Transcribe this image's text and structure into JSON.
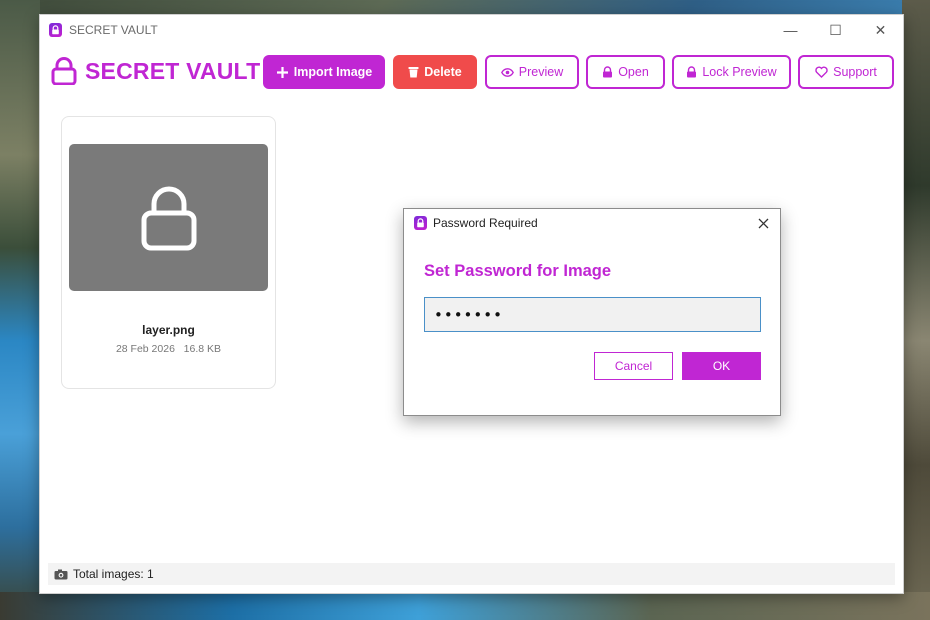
{
  "window": {
    "title": "SECRET VAULT",
    "controls": {
      "minimize": "—",
      "maximize": "☐",
      "close": "✕"
    }
  },
  "brand": {
    "name": "SECRET VAULT",
    "icon": "lock-icon"
  },
  "toolbar": {
    "import_label": "Import Image",
    "delete_label": "Delete",
    "preview_label": "Preview",
    "open_label": "Open",
    "lock_preview_label": "Lock Preview",
    "support_label": "Support"
  },
  "gallery": {
    "items": [
      {
        "name": "layer.png",
        "date": "28 Feb 2026",
        "size": "16.8 KB",
        "meta": "28 Feb 2026   16.8 KB"
      }
    ]
  },
  "status": {
    "text": "Total images: 1"
  },
  "dialog": {
    "title": "Password Required",
    "heading": "Set Password for Image",
    "password_value": "•••••••",
    "cancel_label": "Cancel",
    "ok_label": "OK"
  },
  "colors": {
    "accent": "#c026d3",
    "danger": "#f04b4b",
    "thumb_bg": "#7a7a7a"
  }
}
